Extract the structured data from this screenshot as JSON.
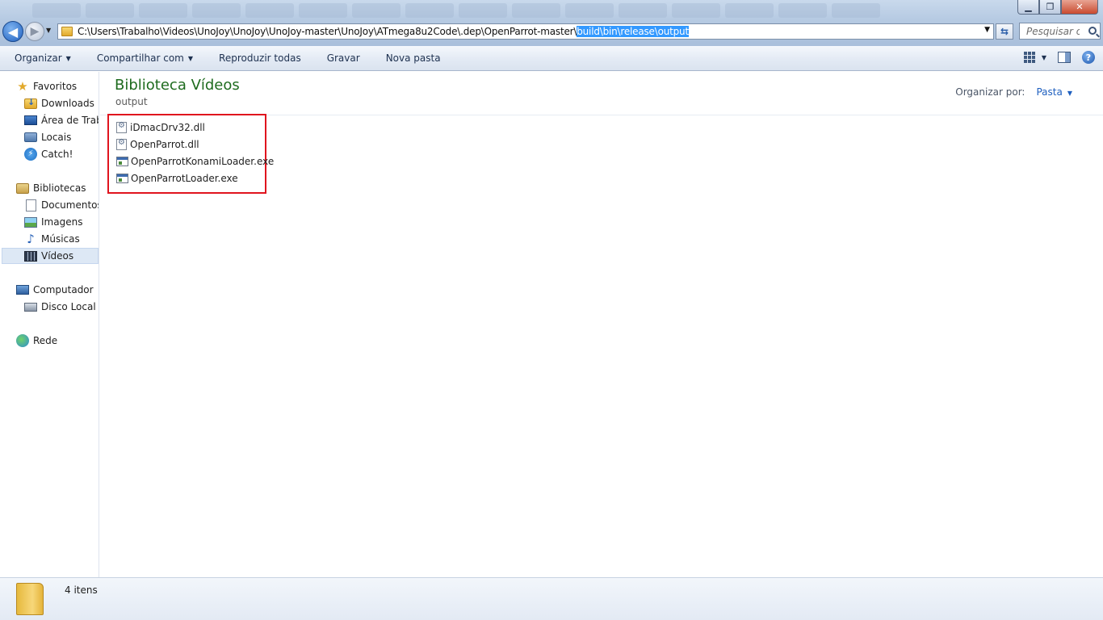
{
  "window": {
    "controls": {
      "minimize": "▁",
      "maximize": "❐",
      "close": "✕"
    }
  },
  "address_bar": {
    "path_prefix": "C:\\Users\\Trabalho\\Videos\\UnoJoy\\UnoJoy\\UnoJoy-master\\UnoJoy\\ATmega8u2Code\\.dep\\OpenParrot-master\\",
    "path_selected": "build\\bin\\release\\output",
    "back_glyph": "◀",
    "forward_glyph": "▶",
    "dropdown_glyph": "▼",
    "refresh_glyph": "⇆"
  },
  "search": {
    "placeholder": "Pesquisar o..."
  },
  "toolbar": {
    "organize": "Organizar",
    "share": "Compartilhar com",
    "play_all": "Reproduzir todas",
    "burn": "Gravar",
    "new_folder": "Nova pasta",
    "help": "?",
    "arrow": "▼"
  },
  "nav": {
    "favorites": "Favoritos",
    "downloads": "Downloads",
    "desktop": "Área de Trabalho",
    "locals": "Locais",
    "catch": "Catch!",
    "libraries": "Bibliotecas",
    "documents": "Documentos",
    "images": "Imagens",
    "music": "Músicas",
    "videos": "Vídeos",
    "computer": "Computador",
    "local_disk": "Disco Local (C:)",
    "network": "Rede",
    "star_glyph": "★",
    "music_glyph": "♪",
    "catch_glyph": "⚡"
  },
  "library": {
    "title": "Biblioteca Vídeos",
    "subtitle": "output",
    "arrange_label": "Organizar por:",
    "arrange_value": "Pasta",
    "arrow": "▼"
  },
  "files": [
    {
      "name": "iDmacDrv32.dll",
      "icon": "dll-file-icon"
    },
    {
      "name": "OpenParrot.dll",
      "icon": "dll-file-icon"
    },
    {
      "name": "OpenParrotKonamiLoader.exe",
      "icon": "exe-file-icon"
    },
    {
      "name": "OpenParrotLoader.exe",
      "icon": "exe-file-icon"
    }
  ],
  "status": {
    "count": "4 itens"
  }
}
